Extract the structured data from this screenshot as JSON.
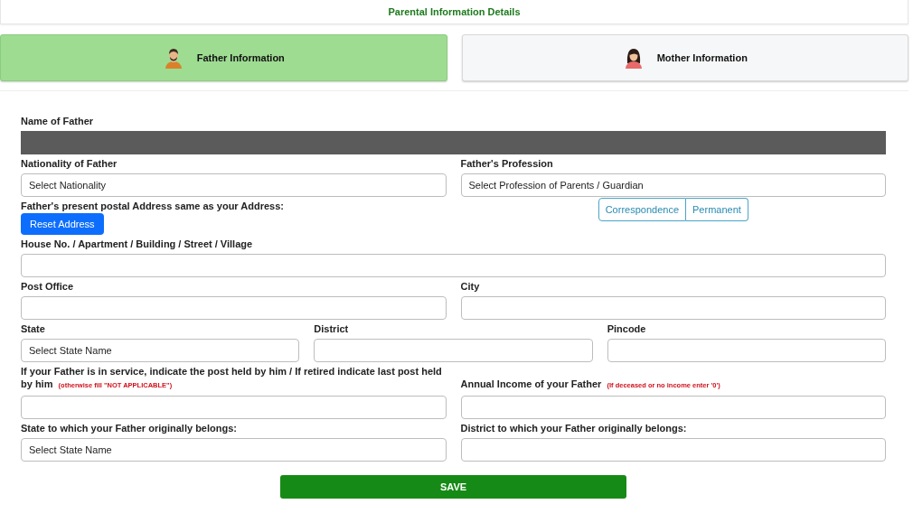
{
  "header": {
    "title": "Parental Information Details"
  },
  "tabs": [
    {
      "label": "Father Information",
      "selected": true,
      "kind": "man"
    },
    {
      "label": "Mother Information",
      "selected": false,
      "kind": "woman"
    }
  ],
  "rows": [
    {
      "kind": "fields",
      "fields": [
        {
          "label": "Name of Father",
          "kind": "redacted"
        }
      ]
    },
    {
      "kind": "fields",
      "fields": [
        {
          "label": "Nationality of Father",
          "kind": "select",
          "placeholder": "Select Nationality"
        },
        {
          "label": "Father's Profession",
          "kind": "select",
          "placeholder": "Select Profession of Parents / Guardian"
        }
      ]
    },
    {
      "kind": "address",
      "label": "Father's present postal Address same as your Address:",
      "button": "Reset Address",
      "options": [
        {
          "label": "Correspondence",
          "selected": false
        },
        {
          "label": "Permanent",
          "selected": false
        }
      ]
    },
    {
      "kind": "fields",
      "fields": [
        {
          "label": "House No. / Apartment / Building / Street / Village",
          "kind": "text"
        }
      ]
    },
    {
      "kind": "fields",
      "fields": [
        {
          "label": "Post Office",
          "kind": "text"
        },
        {
          "label": "City",
          "kind": "text"
        }
      ]
    },
    {
      "kind": "fields",
      "fields": [
        {
          "label": "State",
          "kind": "select",
          "placeholder": "Select State Name"
        },
        {
          "label": "District",
          "kind": "text"
        },
        {
          "label": "Pincode",
          "kind": "text"
        }
      ]
    },
    {
      "kind": "fields",
      "fields": [
        {
          "label": "If your Father is in service, indicate the post held by him / If retired indicate last post held by him",
          "note": "(otherwise fill \"NOT APPLICABLE\")",
          "kind": "text"
        },
        {
          "label": "Annual Income of your Father",
          "note": "(If deceased or no income enter '0')",
          "kind": "text"
        }
      ]
    },
    {
      "kind": "fields",
      "fields": [
        {
          "label": "State to which your Father originally belongs:",
          "kind": "select",
          "placeholder": "Select State Name"
        },
        {
          "label": "District to which your Father originally belongs:",
          "kind": "text"
        }
      ]
    }
  ],
  "save": "SAVE"
}
